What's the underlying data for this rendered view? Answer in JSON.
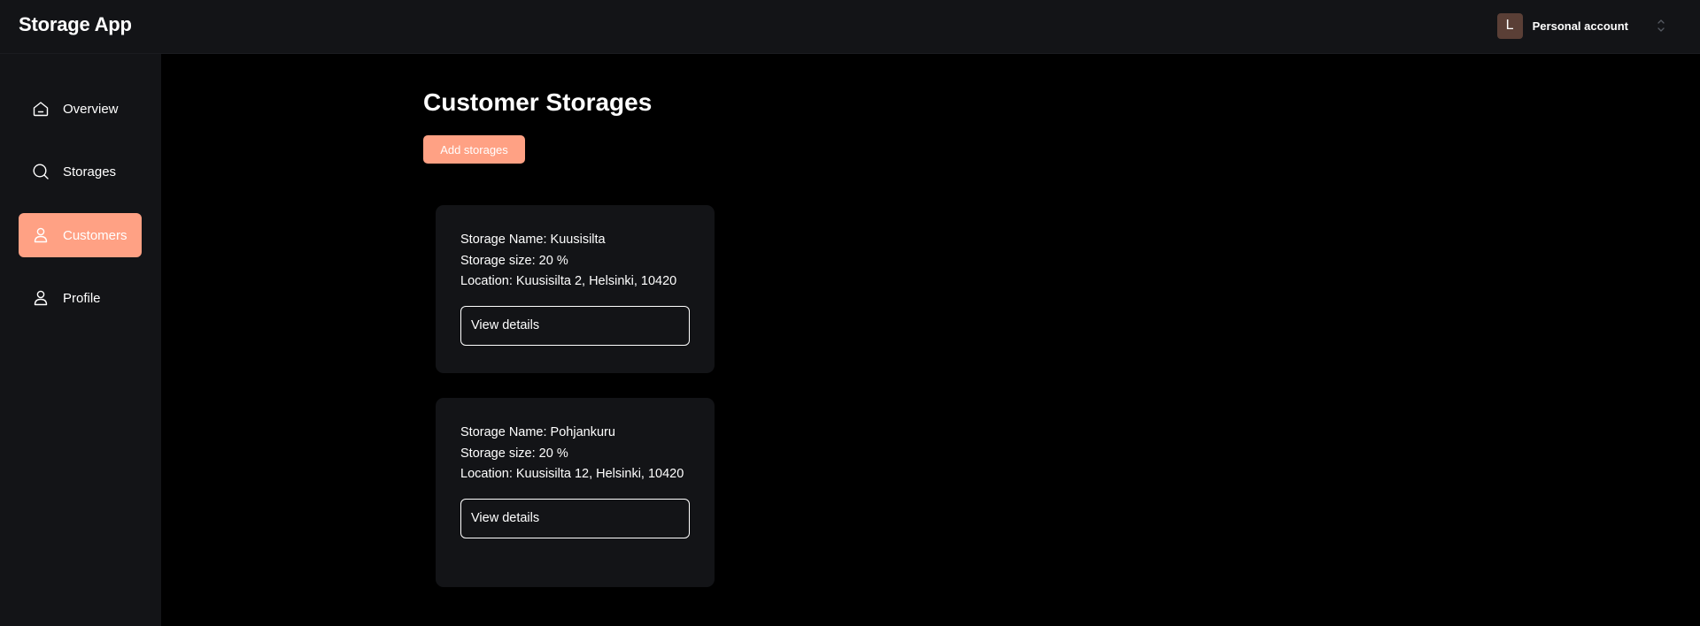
{
  "app": {
    "title": "Storage App"
  },
  "account": {
    "avatar_initial": "L",
    "label": "Personal account"
  },
  "sidebar": {
    "items": [
      {
        "label": "Overview",
        "icon": "home-icon",
        "active": false
      },
      {
        "label": "Storages",
        "icon": "search-icon",
        "active": false
      },
      {
        "label": "Customers",
        "icon": "user-icon",
        "active": true
      },
      {
        "label": "Profile",
        "icon": "user-icon",
        "active": false
      }
    ]
  },
  "main": {
    "title": "Customer Storages",
    "add_button_label": "Add storages",
    "cards": [
      {
        "name_line": "Storage Name: Kuusisilta",
        "size_line": "Storage size: 20 %",
        "location_line": "Location: Kuusisilta 2, Helsinki, 10420",
        "button_label": "View details"
      },
      {
        "name_line": "Storage Name: Pohjankuru",
        "size_line": "Storage size: 20 %",
        "location_line": "Location: Kuusisilta 12, Helsinki, 10420",
        "button_label": "View details"
      }
    ]
  },
  "colors": {
    "accent": "#ffa184",
    "panel": "#131417",
    "background": "#000000",
    "avatar": "#5a3f36"
  }
}
